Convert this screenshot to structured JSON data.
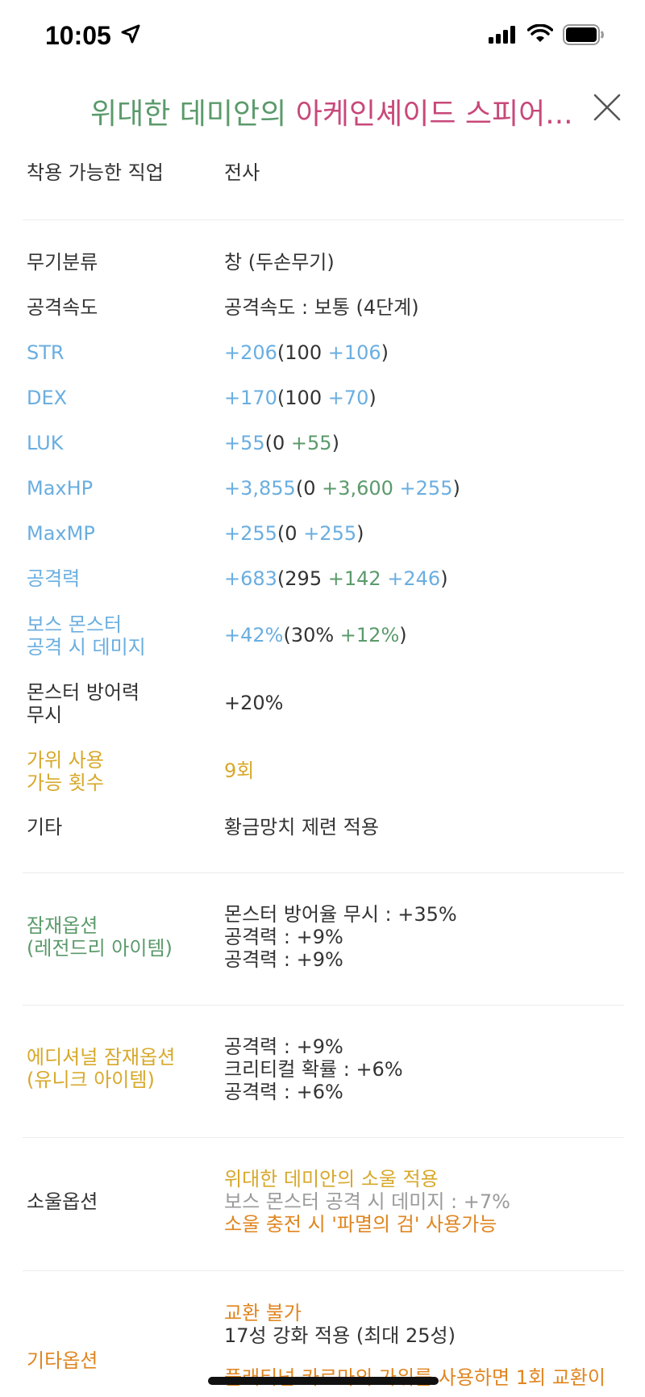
{
  "status": {
    "time": "10:05"
  },
  "header": {
    "title_part1": "위대한 데미안의 ",
    "title_part2": "아케인셰이드 스피어...",
    "title_color1": "#5b9a6b",
    "title_color2": "#c8487a",
    "close_icon": "close-icon"
  },
  "rows": {
    "job": {
      "label": "착용 가능한 직업",
      "value": "전사"
    },
    "weapon_type": {
      "label": "무기분류",
      "value": "창 (두손무기)"
    },
    "attack_speed": {
      "label": "공격속도",
      "value": "공격속도 : 보통 (4단계)"
    },
    "str": {
      "label": "STR",
      "total": "+206",
      "open": "(100 ",
      "bonus": "+106",
      "close": ")"
    },
    "dex": {
      "label": "DEX",
      "total": "+170",
      "open": "(100 ",
      "bonus": "+70",
      "close": ")"
    },
    "luk": {
      "label": "LUK",
      "total": "+55",
      "open": "(0 ",
      "bonus": "+55",
      "close": ")"
    },
    "maxhp": {
      "label": "MaxHP",
      "total": "+3,855",
      "open": "(0 ",
      "bonus1": "+3,600",
      "bonus2": " +255",
      "close": ")"
    },
    "maxmp": {
      "label": "MaxMP",
      "total": "+255",
      "open": "(0 ",
      "bonus": "+255",
      "close": ")"
    },
    "attack": {
      "label": "공격력",
      "total": "+683",
      "open": "(295 ",
      "bonus1": "+142",
      "bonus2": " +246",
      "close": ")"
    },
    "boss": {
      "label1": "보스 몬스터",
      "label2": "공격 시 데미지",
      "total": "+42%",
      "open": "(30% ",
      "bonus": "+12%",
      "close": ")"
    },
    "ignore_def": {
      "label1": "몬스터 방어력",
      "label2": "무시",
      "value": "+20%"
    },
    "scissors": {
      "label1": "가위 사용",
      "label2": "가능 횟수",
      "value": "9회"
    },
    "etc": {
      "label": "기타",
      "value": "황금망치 제련 적용"
    },
    "potential": {
      "label1": "잠재옵션",
      "label2": "(레전드리 아이템)",
      "lines": [
        "몬스터 방어율 무시 : +35%",
        "공격력 : +9%",
        "공격력 : +9%"
      ]
    },
    "additional": {
      "label1": "에디셔널 잠재옵션",
      "label2": "(유니크 아이템)",
      "lines": [
        "공격력 : +9%",
        "크리티컬 확률 : +6%",
        "공격력 : +6%"
      ]
    },
    "soul": {
      "label": "소울옵션",
      "line1": "위대한 데미안의 소울 적용",
      "line2": "보스 몬스터 공격 시 데미지 : +7%",
      "line3": "소울 충전 시 '파멸의 검' 사용가능"
    },
    "other": {
      "label": "기타옵션",
      "line1": "교환 불가",
      "line2": "17성 강화 적용 (최대 25성)",
      "line3": "플래티넘 카르마의 가위를 사용하면 1회 교환이"
    }
  },
  "colors": {
    "blue": "#6aaee0",
    "green": "#5b9a6b",
    "gold": "#d7a82a",
    "orange": "#e0851f",
    "gray": "#9a9a9a"
  }
}
